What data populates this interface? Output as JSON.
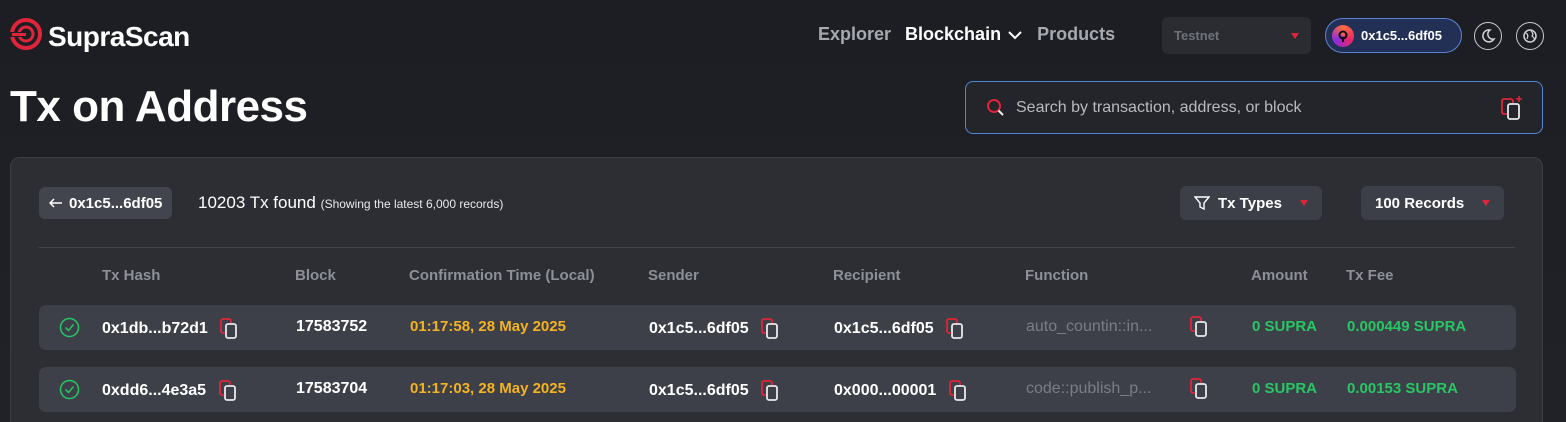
{
  "header": {
    "brand": "SupraScan",
    "nav": [
      {
        "label": "Explorer"
      },
      {
        "label": "Blockchain"
      },
      {
        "label": "Products"
      }
    ],
    "network": "Testnet",
    "wallet": "0x1c5...6df05"
  },
  "page": {
    "title": "Tx on Address",
    "search_placeholder": "Search by transaction, address, or block"
  },
  "panel": {
    "back_label": "0x1c5...6df05",
    "found_text": "10203 Tx found",
    "found_note": "(Showing the latest 6,000 records)",
    "filter_label": "Tx Types",
    "records_label": "100 Records"
  },
  "table": {
    "columns": [
      "Tx Hash",
      "Block",
      "Confirmation Time (Local)",
      "Sender",
      "Recipient",
      "Function",
      "Amount",
      "Tx Fee"
    ],
    "rows": [
      {
        "hash": "0x1db...b72d1",
        "block": "17583752",
        "time": "01:17:58, 28 May 2025",
        "sender": "0x1c5...6df05",
        "recipient": "0x1c5...6df05",
        "function": "auto_countin::in...",
        "amount": "0 SUPRA",
        "fee": "0.000449 SUPRA"
      },
      {
        "hash": "0xdd6...4e3a5",
        "block": "17583704",
        "time": "01:17:03, 28 May 2025",
        "sender": "0x1c5...6df05",
        "recipient": "0x000...00001",
        "function": "code::publish_p...",
        "amount": "0 SUPRA",
        "fee": "0.00153 SUPRA"
      }
    ]
  },
  "colors": {
    "accent": "#e0243a",
    "time": "#f5b221",
    "success": "#27c764",
    "focus": "#4d86d4"
  }
}
